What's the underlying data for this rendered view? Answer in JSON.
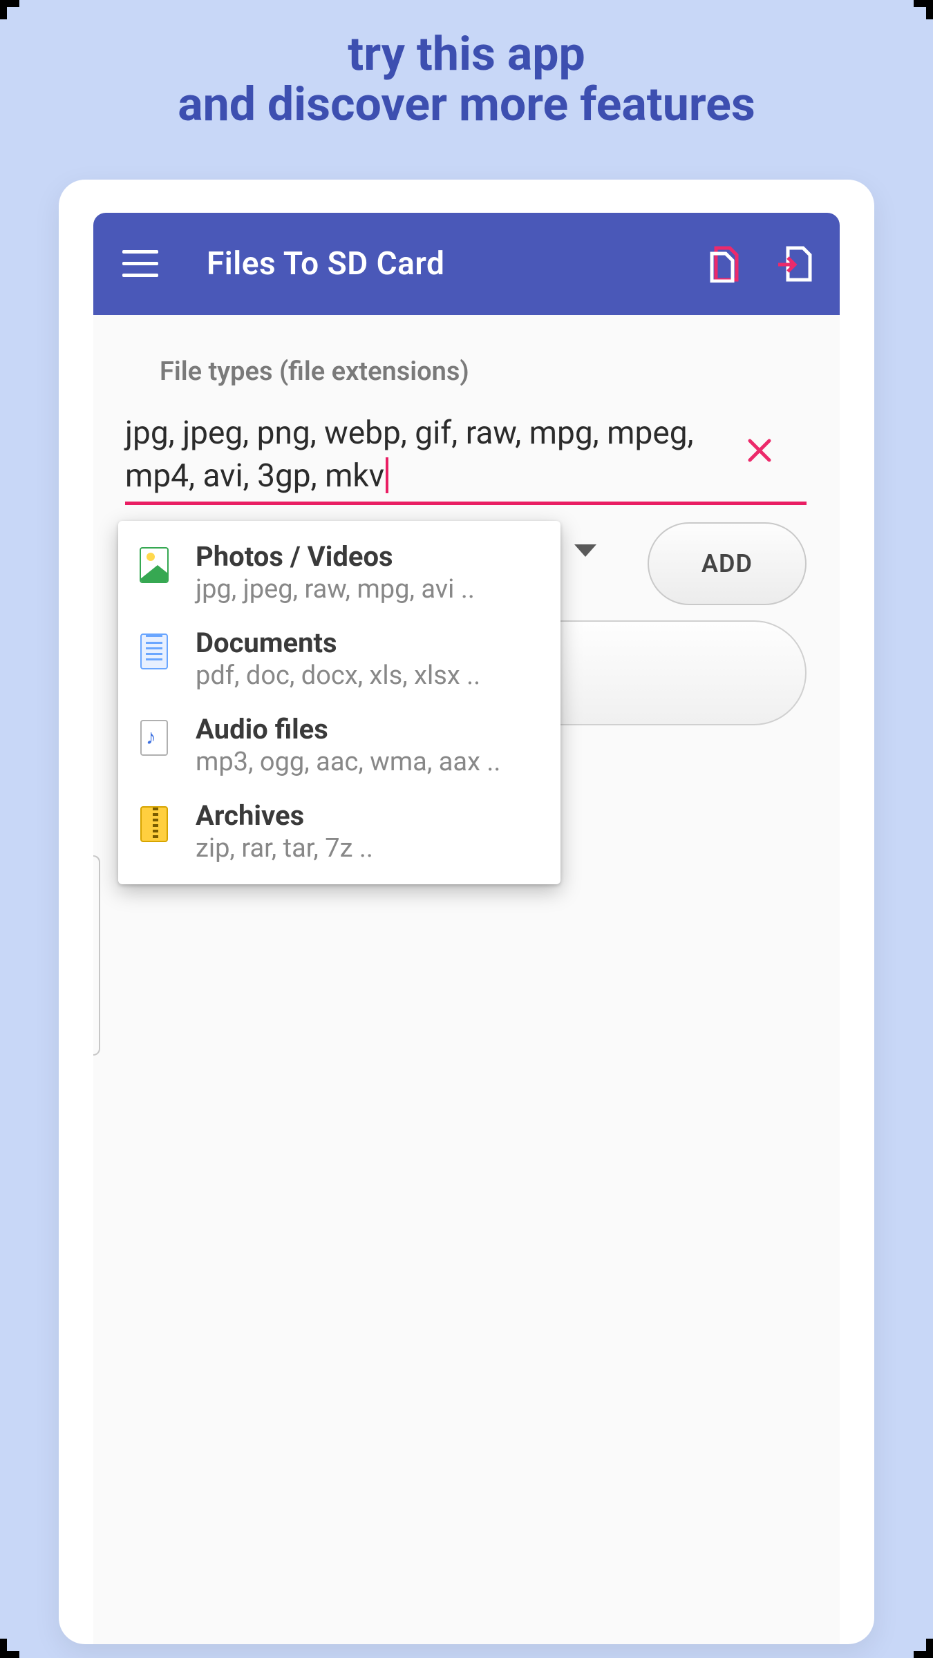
{
  "promo": {
    "line1": "try this app",
    "line2": "and discover more features"
  },
  "appbar": {
    "title": "Files To SD Card"
  },
  "filetypes": {
    "label": "File types (file extensions)",
    "input_value": "jpg, jpeg, png, webp, gif, raw, mpg, mpeg, mp4, avi, 3gp, mkv",
    "add_button": "ADD"
  },
  "dropdown": {
    "items": [
      {
        "title": "Photos / Videos",
        "sub": "jpg, jpeg, raw, mpg, avi .."
      },
      {
        "title": "Documents",
        "sub": "pdf, doc, docx, xls, xlsx .."
      },
      {
        "title": "Audio files",
        "sub": "mp3, ogg, aac, wma, aax  .."
      },
      {
        "title": "Archives",
        "sub": "zip, rar, tar, 7z .."
      }
    ]
  },
  "colors": {
    "accent": "#4a58b8",
    "highlight": "#e91e63"
  }
}
